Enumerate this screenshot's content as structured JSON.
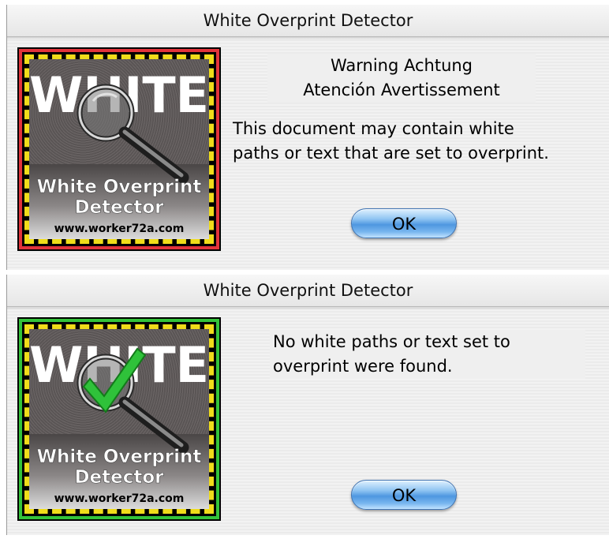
{
  "dialogs": [
    {
      "title": "White Overprint Detector",
      "warning_line1": "Warning  Achtung",
      "warning_line2": "Atención  Avertissement",
      "message_line1": "This document may contain white",
      "message_line2": "paths or text that are set to overprint.",
      "ok_label": "OK",
      "logo": {
        "word": "WHITE",
        "product_line1": "White Overprint",
        "product_line2": "Detector",
        "url": "www.worker72a.com",
        "frame_color": "#e2343b",
        "icon": "magnifier-icon"
      }
    },
    {
      "title": "White Overprint Detector",
      "message_line1": "No white paths or text set to",
      "message_line2": "overprint were found.",
      "ok_label": "OK",
      "logo": {
        "word": "WHITE",
        "product_line1": "White Overprint",
        "product_line2": "Detector",
        "url": "www.worker72a.com",
        "frame_color": "#34c33a",
        "icon": "checkmark-icon"
      }
    }
  ]
}
